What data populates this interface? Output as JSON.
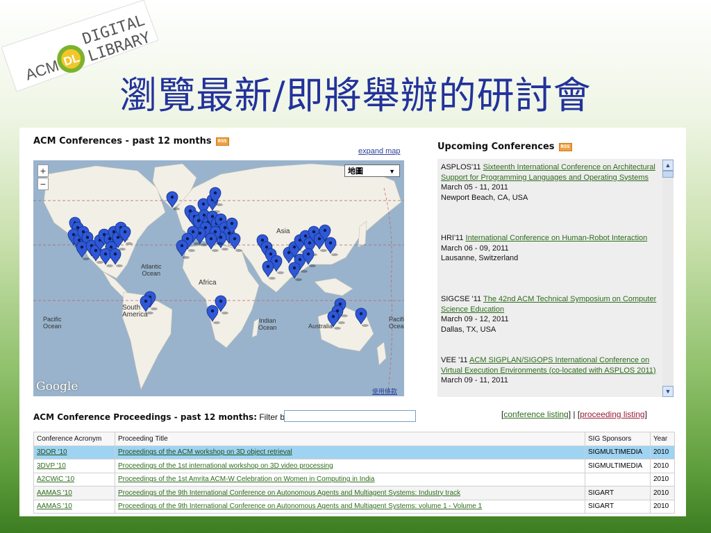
{
  "logo": {
    "acm": "ACM",
    "dl": "DL",
    "line1": "DIGITAL",
    "line2": "LIBRARY"
  },
  "slide_title": "瀏覽最新/即將舉辦的研討會",
  "colors": {
    "title": "#22329a",
    "link_green": "#2e6b1c",
    "link_red": "#9b1c3a",
    "highlight_row": "#9fd3f2",
    "map_pin": "#2f58d8"
  },
  "conferences_panel": {
    "heading": "ACM Conferences - past 12 months",
    "rss_icon": "rss-icon",
    "expand_map": "expand map",
    "map": {
      "zoom_in": "+",
      "zoom_out": "−",
      "type_select": "地圖",
      "labels": {
        "asia": "Asia",
        "atlantic": "Atlantic\nOcean",
        "africa": "Africa",
        "south_america": "South\nAmerica",
        "pacific_left": "Pacific\nOcean",
        "indian": "Indian\nOcean",
        "australia": "Australia",
        "pacific_right": "Pacific\nOcean"
      },
      "google": "Google",
      "terms": "使用條款"
    }
  },
  "upcoming": {
    "heading": "Upcoming Conferences",
    "items": [
      {
        "acronym": "ASPLOS'11 ",
        "title": "Sixteenth International Conference on Architectural Support for Programming Languages and Operating Systems",
        "dates": "March 05 - 11, 2011",
        "location": "Newport Beach, CA, USA"
      },
      {
        "acronym": "HRI'11 ",
        "title": "International Conference on Human-Robot Interaction",
        "dates": "March 06 - 09, 2011",
        "location": "Lausanne, Switzerland"
      },
      {
        "acronym": "SIGCSE '11 ",
        "title": "The 42nd ACM Technical Symposium on Computer Science Education",
        "dates": "March 09 - 12, 2011",
        "location": "Dallas, TX, USA"
      },
      {
        "acronym": "VEE '11 ",
        "title": "ACM SIGPLAN/SIGOPS International Conference on Virtual Execution Environments (co-located with ASPLOS 2011)",
        "dates": "March 09 - 11, 2011",
        "location": ""
      }
    ]
  },
  "proceedings": {
    "heading": "ACM Conference Proceedings - past 12 months:",
    "filter_label": "Filter by",
    "filter_value": "",
    "link_open": "[",
    "link_conference": "conference listing",
    "link_sep": "] | [",
    "link_proceeding": "proceeding listing",
    "link_close": "]",
    "columns": [
      "Conference Acronym",
      "Proceeding Title",
      "SIG Sponsors",
      "Year"
    ],
    "rows": [
      {
        "acronym": "3DOR '10",
        "title": "Proceedings of the ACM workshop on 3D object retrieval",
        "sig": "SIGMULTIMEDIA",
        "year": "2010"
      },
      {
        "acronym": "3DVP '10",
        "title": "Proceedings of the 1st international workshop on 3D video processing",
        "sig": "SIGMULTIMEDIA",
        "year": "2010"
      },
      {
        "acronym": "A2CWiC '10",
        "title": "Proceedings of the 1st Amrita ACM-W Celebration on Women in Computing in India",
        "sig": "",
        "year": "2010"
      },
      {
        "acronym": "AAMAS '10",
        "title": "Proceedings of the 9th International Conference on Autonomous Agents and Multiagent Systems: Industry track",
        "sig": "SIGART",
        "year": "2010"
      },
      {
        "acronym": "AAMAS '10",
        "title": "Proceedings of the 9th International Conference on Autonomous Agents and Multiagent Systems: volume 1 - Volume 1",
        "sig": "SIGART",
        "year": "2010"
      }
    ]
  }
}
